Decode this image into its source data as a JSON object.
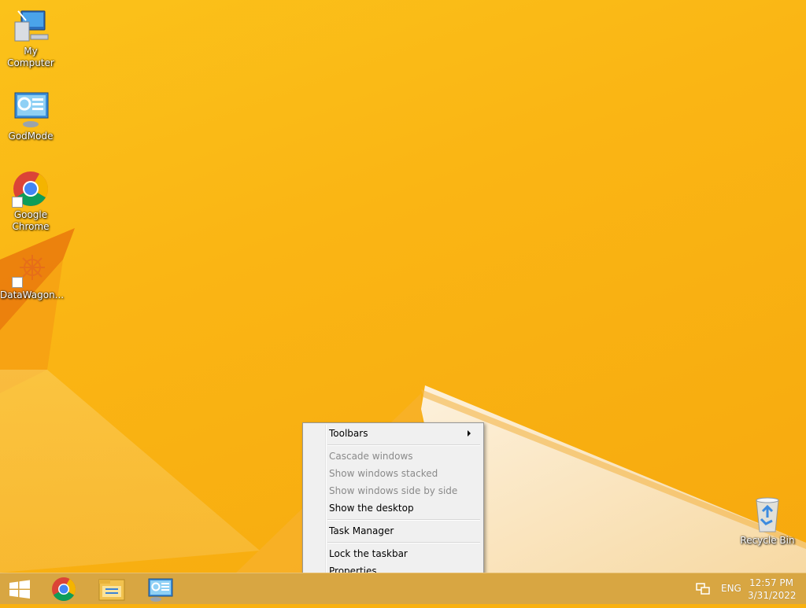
{
  "desktop": {
    "icons": [
      {
        "label": "My Computer",
        "icon": "computer-icon"
      },
      {
        "label": "GodMode",
        "icon": "control-panel-icon"
      },
      {
        "label": "Google Chrome",
        "icon": "chrome-icon"
      },
      {
        "label": "DataWagon...",
        "icon": "datawagon-icon"
      },
      {
        "label": "Recycle Bin",
        "icon": "recycle-bin-icon"
      }
    ]
  },
  "context_menu": {
    "items": [
      {
        "label": "Toolbars",
        "enabled": true,
        "has_submenu": true
      },
      {
        "label": "Cascade windows",
        "enabled": false
      },
      {
        "label": "Show windows stacked",
        "enabled": false
      },
      {
        "label": "Show windows side by side",
        "enabled": false
      },
      {
        "label": "Show the desktop",
        "enabled": true
      },
      {
        "label": "Task Manager",
        "enabled": true
      },
      {
        "label": "Lock the taskbar",
        "enabled": true
      },
      {
        "label": "Properties",
        "enabled": true
      }
    ]
  },
  "taskbar": {
    "buttons": [
      {
        "icon": "windows-start-icon"
      },
      {
        "icon": "chrome-icon"
      },
      {
        "icon": "file-explorer-icon"
      },
      {
        "icon": "control-panel-icon"
      }
    ],
    "tray": {
      "language": "ENG",
      "time": "12:57 PM",
      "date": "3/31/2022",
      "network_icon": "network-icon"
    }
  },
  "colors": {
    "wallpaper": "#f9b10f",
    "menu_bg": "#f0f0f0",
    "disabled_text": "#8a8a8a"
  }
}
